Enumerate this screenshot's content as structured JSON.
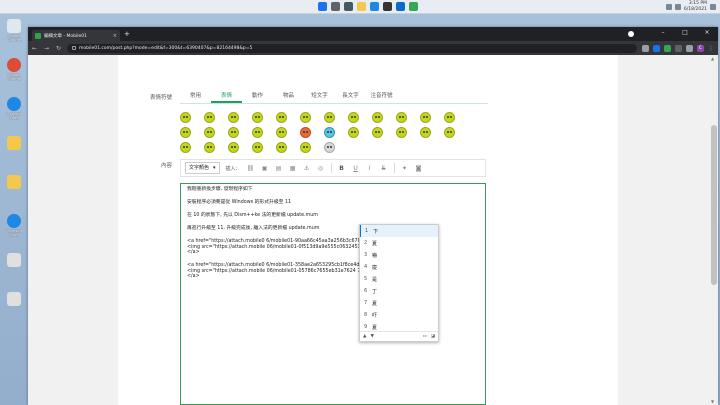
{
  "desktop": {
    "icons": [
      {
        "label": "Google Chrome",
        "color": "#ffffff"
      },
      {
        "label": "Google Chrome",
        "color": "#dd4b39"
      },
      {
        "label": "Microsoft Edge",
        "color": "#1e88e5"
      },
      {
        "label": "",
        "color": "#f2c94c"
      },
      {
        "label": "",
        "color": "#f2c94c"
      },
      {
        "label": "",
        "color": "#f2c94c"
      },
      {
        "label": "Microsoft Edge",
        "color": "#1e88e5"
      },
      {
        "label": "",
        "color": "#e0e0e0"
      },
      {
        "label": "",
        "color": "#e0e0e0"
      }
    ]
  },
  "taskbar": {
    "time": "3:15 PM",
    "date": "6/18/2021"
  },
  "browser": {
    "tab_title": "編輯文章 - Mobile01",
    "tab_close": "×",
    "new_tab": "+",
    "url": "mobile01.com/post.php?mode=edit&f=300&t=6390407&p=82164498&p=5",
    "profile_initial": "C",
    "win_min": "–",
    "win_max": "□",
    "win_close": "×"
  },
  "emoticons": {
    "label": "表情符號",
    "tabs": [
      "常用",
      "表情",
      "動作",
      "物品",
      "短文字",
      "長文字",
      "注音符號"
    ],
    "active_tab": 1
  },
  "editor": {
    "content_label": "內容",
    "format_select": "文字顏色",
    "insert_label": "插入：",
    "lines": [
      "我剛重新換步驟, 發現程序如下",
      "安裝程序必須要是從 Windows                        的形式升級至 11",
      "在 10 的狀態下, 先以 Dism++ke                         法的更新檔 update.mum",
      "再進行升級至 11, 升級完成後,                         離入法的更新檔 update.mum",
      "<a href=\"https://attach.mobile0                         6/mobile01-90aa66c45aa3a256b3c670f4df6fb493.png\">",
      "<img src=\"https://attach.mobile                         06/mobile01-0f513d9a9e555c06324510a8a5395e7f.png\">",
      "</a>",
      "<a href=\"https://attach.mobile0                         6/mobile01-358ae2a653295cb1f8ce4d0b10adef24.png\">",
      "<img src=\"https://attach.mobile                         06/mobile01-05786c7655eb31e7624 7f6d64a1b3692.png\">",
      "</a>"
    ]
  },
  "ime": {
    "candidates": [
      {
        "num": "1",
        "char": "下"
      },
      {
        "num": "2",
        "char": "夏"
      },
      {
        "num": "3",
        "char": "嚇"
      },
      {
        "num": "4",
        "char": "廈"
      },
      {
        "num": "5",
        "char": "是"
      },
      {
        "num": "6",
        "char": "丁"
      },
      {
        "num": "7",
        "char": "夏"
      },
      {
        "num": "8",
        "char": "吓"
      },
      {
        "num": "9",
        "char": "夏"
      }
    ],
    "prev": "▲",
    "next": "▼"
  }
}
